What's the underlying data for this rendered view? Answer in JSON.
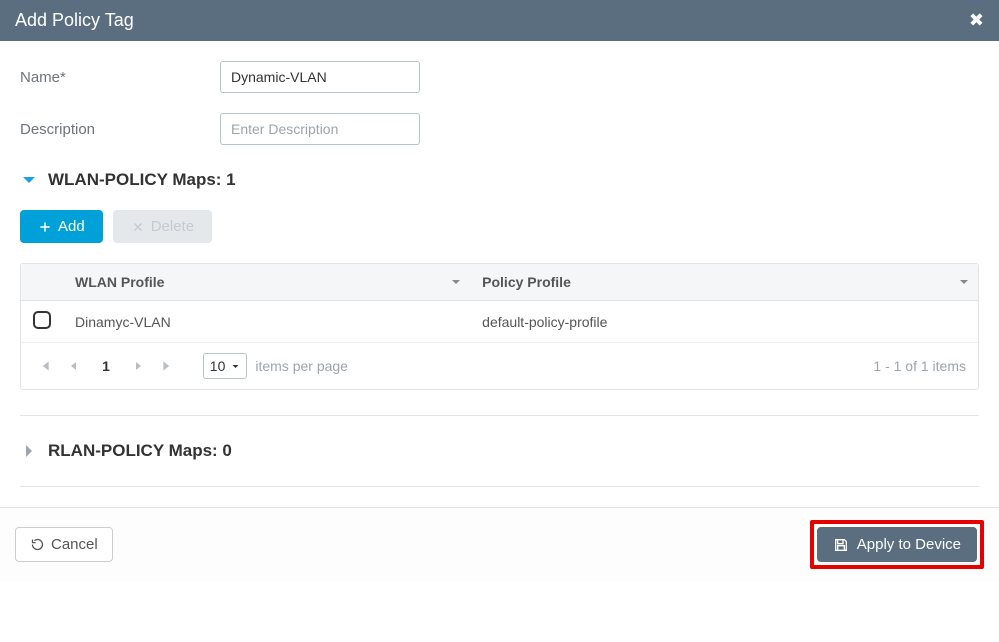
{
  "header": {
    "title": "Add Policy Tag"
  },
  "form": {
    "name_label": "Name*",
    "name_value": "Dynamic-VLAN",
    "desc_label": "Description",
    "desc_placeholder": "Enter Description"
  },
  "sections": {
    "wlan": {
      "label": "WLAN-POLICY Maps: 1"
    },
    "rlan": {
      "label": "RLAN-POLICY Maps: 0"
    }
  },
  "buttons": {
    "add": "Add",
    "delete": "Delete",
    "cancel": "Cancel",
    "apply": "Apply to Device"
  },
  "table": {
    "columns": [
      "WLAN Profile",
      "Policy Profile"
    ],
    "rows": [
      {
        "wlan": "Dinamyc-VLAN",
        "policy": "default-policy-profile"
      }
    ]
  },
  "pager": {
    "page": "1",
    "per_page": "10",
    "per_page_label": "items per page",
    "info": "1 - 1 of 1 items"
  }
}
